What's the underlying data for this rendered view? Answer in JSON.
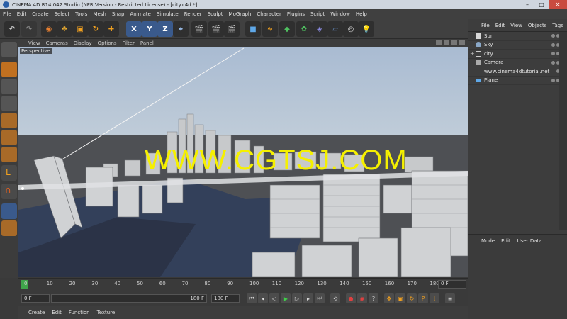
{
  "window": {
    "title": "CINEMA 4D R14.042 Studio (NFR Version - Restricted License) - [city.c4d *]",
    "controls": [
      "–",
      "□",
      "✕"
    ]
  },
  "menubar": [
    "File",
    "Edit",
    "Create",
    "Select",
    "Tools",
    "Mesh",
    "Snap",
    "Animate",
    "Simulate",
    "Render",
    "Sculpt",
    "MoGraph",
    "Character",
    "Plugins",
    "Script",
    "Window",
    "Help"
  ],
  "toolbar": {
    "axis": [
      "X",
      "Y",
      "Z"
    ]
  },
  "viewport": {
    "menu": [
      "View",
      "Cameras",
      "Display",
      "Options",
      "Filter",
      "Panel"
    ],
    "label": "Perspective",
    "watermark": "WWW.CGTSJ.COM"
  },
  "timeline": {
    "ticks": [
      "0",
      "10",
      "20",
      "30",
      "40",
      "50",
      "60",
      "70",
      "80",
      "90",
      "100",
      "110",
      "120",
      "130",
      "140",
      "150",
      "160",
      "170",
      "180"
    ],
    "current_frame": "0 F"
  },
  "transport": {
    "start_frame": "0 F",
    "range_end": "180 F",
    "end_frame": "180 F"
  },
  "material_menu": [
    "Create",
    "Edit",
    "Function",
    "Texture"
  ],
  "object_manager": {
    "menu": [
      "File",
      "Edit",
      "View",
      "Objects",
      "Tags"
    ],
    "objects": [
      {
        "name": "Sun",
        "icon": "light-icon"
      },
      {
        "name": "Sky",
        "icon": "sky-icon"
      },
      {
        "name": "city",
        "icon": "null-icon"
      },
      {
        "name": "Camera",
        "icon": "camera-icon"
      },
      {
        "name": "www.cinema4dtutorial.net",
        "icon": "null-icon"
      },
      {
        "name": "Plane",
        "icon": "plane-icon"
      }
    ]
  },
  "attribute_manager": {
    "menu": [
      "Mode",
      "Edit",
      "User Data"
    ]
  },
  "colors": {
    "accent": "#3a5a8c",
    "watermark": "#f5f000",
    "sky": "#b4c3d6"
  }
}
